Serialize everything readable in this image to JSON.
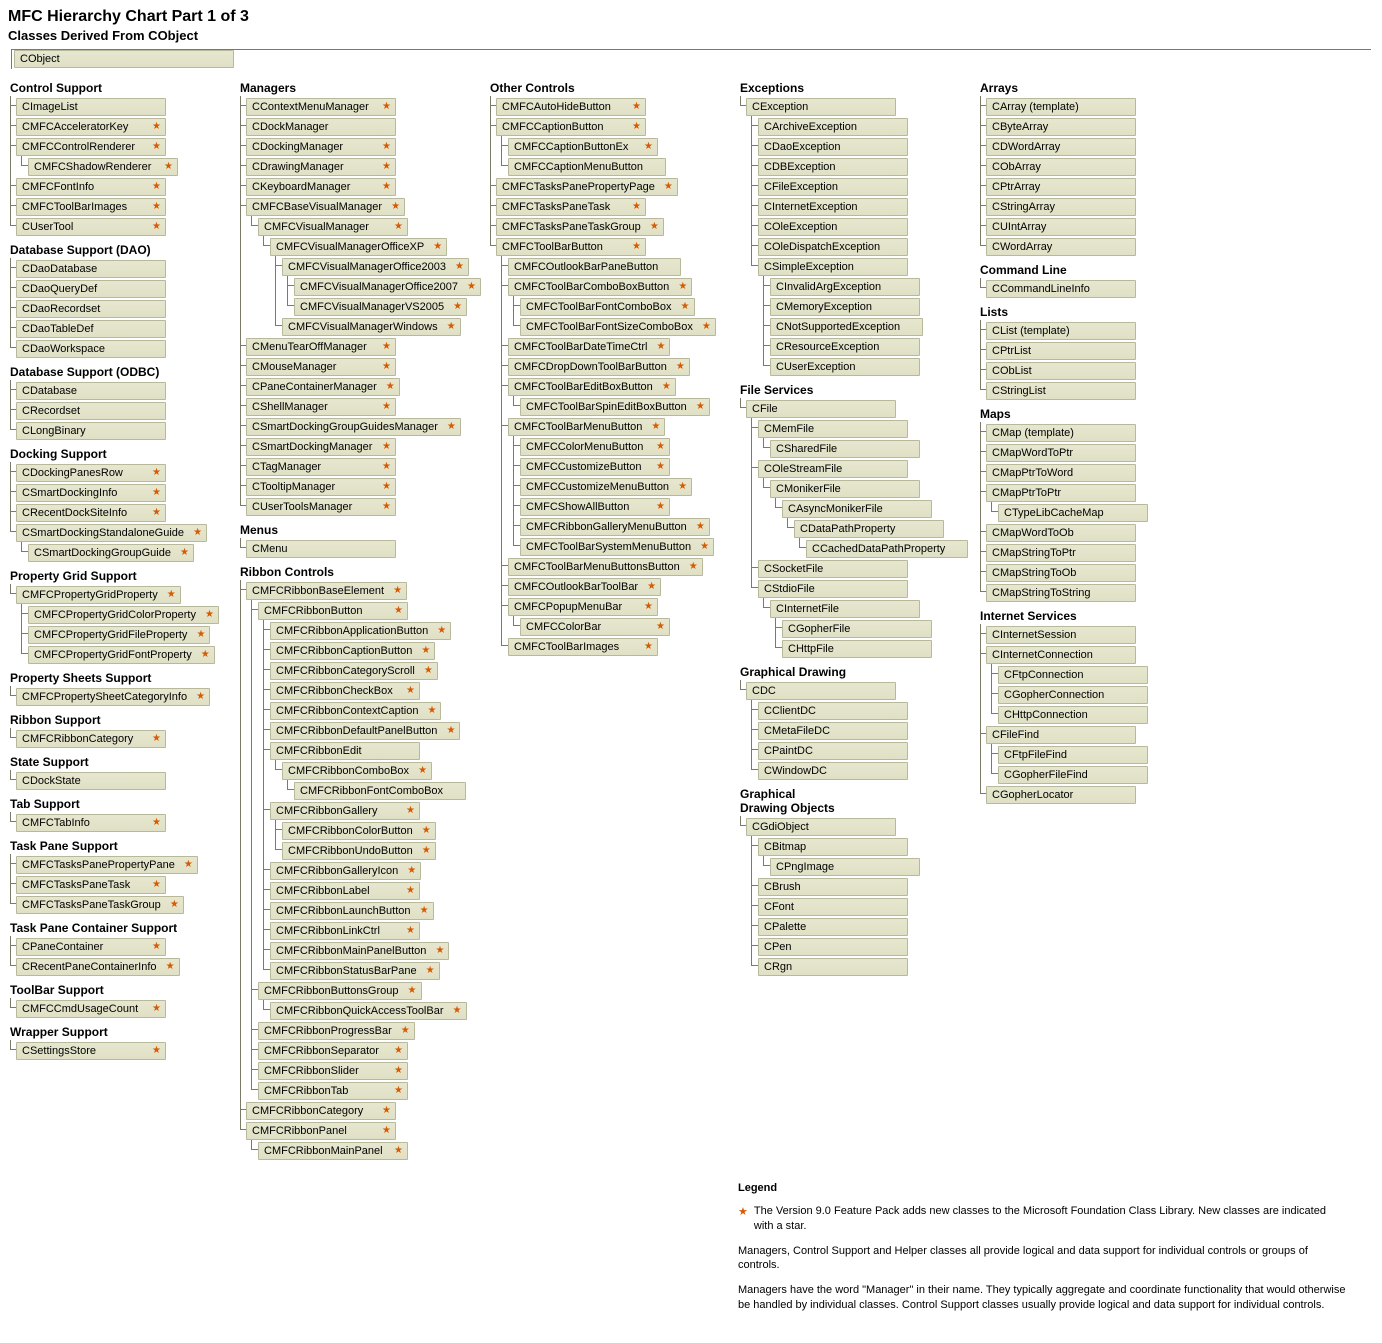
{
  "title": "MFC Hierarchy Chart Part 1 of 3",
  "subtitle": "Classes Derived From CObject",
  "root": "CObject",
  "icons": {
    "star": "star-icon"
  },
  "col1": [
    {
      "heading": "Control Support",
      "items": [
        {
          "n": "CImageList"
        },
        {
          "n": "CMFCAcceleratorKey",
          "s": true
        },
        {
          "n": "CMFCControlRenderer",
          "s": true,
          "c": [
            {
              "n": "CMFCShadowRenderer",
              "s": true
            }
          ]
        },
        {
          "n": "CMFCFontInfo",
          "s": true
        },
        {
          "n": "CMFCToolBarImages",
          "s": true
        },
        {
          "n": "CUserTool",
          "s": true
        }
      ]
    },
    {
      "heading": "Database Support (DAO)",
      "items": [
        {
          "n": "CDaoDatabase"
        },
        {
          "n": "CDaoQueryDef"
        },
        {
          "n": "CDaoRecordset"
        },
        {
          "n": "CDaoTableDef"
        },
        {
          "n": "CDaoWorkspace"
        }
      ]
    },
    {
      "heading": "Database Support (ODBC)",
      "items": [
        {
          "n": "CDatabase"
        },
        {
          "n": "CRecordset"
        },
        {
          "n": "CLongBinary"
        }
      ]
    },
    {
      "heading": "Docking Support",
      "items": [
        {
          "n": "CDockingPanesRow",
          "s": true
        },
        {
          "n": "CSmartDockingInfo",
          "s": true
        },
        {
          "n": "CRecentDockSiteInfo",
          "s": true
        },
        {
          "n": "CSmartDockingStandaloneGuide",
          "s": true,
          "c": [
            {
              "n": "CSmartDockingGroupGuide",
              "s": true
            }
          ]
        }
      ]
    },
    {
      "heading": "Property Grid Support",
      "items": [
        {
          "n": "CMFCPropertyGridProperty",
          "s": true,
          "c": [
            {
              "n": "CMFCPropertyGridColorProperty",
              "s": true
            },
            {
              "n": "CMFCPropertyGridFileProperty",
              "s": true
            },
            {
              "n": "CMFCPropertyGridFontProperty",
              "s": true
            }
          ]
        }
      ]
    },
    {
      "heading": "Property Sheets Support",
      "items": [
        {
          "n": "CMFCPropertySheetCategoryInfo",
          "s": true
        }
      ]
    },
    {
      "heading": "Ribbon Support",
      "items": [
        {
          "n": "CMFCRibbonCategory",
          "s": true
        }
      ]
    },
    {
      "heading": "State Support",
      "items": [
        {
          "n": "CDockState"
        }
      ]
    },
    {
      "heading": "Tab Support",
      "items": [
        {
          "n": "CMFCTabInfo",
          "s": true
        }
      ]
    },
    {
      "heading": "Task Pane Support",
      "items": [
        {
          "n": "CMFCTasksPanePropertyPane",
          "s": true
        },
        {
          "n": "CMFCTasksPaneTask",
          "s": true
        },
        {
          "n": "CMFCTasksPaneTaskGroup",
          "s": true
        }
      ]
    },
    {
      "heading": "Task Pane Container Support",
      "items": [
        {
          "n": "CPaneContainer",
          "s": true
        },
        {
          "n": "CRecentPaneContainerInfo",
          "s": true
        }
      ]
    },
    {
      "heading": "ToolBar Support",
      "items": [
        {
          "n": "CMFCCmdUsageCount",
          "s": true
        }
      ]
    },
    {
      "heading": "Wrapper Support",
      "items": [
        {
          "n": "CSettingsStore",
          "s": true
        }
      ]
    }
  ],
  "col2": [
    {
      "heading": "Managers",
      "items": [
        {
          "n": "CContextMenuManager",
          "s": true
        },
        {
          "n": "CDockManager"
        },
        {
          "n": "CDockingManager",
          "s": true
        },
        {
          "n": "CDrawingManager",
          "s": true
        },
        {
          "n": "CKeyboardManager",
          "s": true
        },
        {
          "n": "CMFCBaseVisualManager",
          "s": true,
          "c": [
            {
              "n": "CMFCVisualManager",
              "s": true,
              "c": [
                {
                  "n": "CMFCVisualManagerOfficeXP",
                  "s": true,
                  "c": [
                    {
                      "n": "CMFCVisualManagerOffice2003",
                      "s": true,
                      "c": [
                        {
                          "n": "CMFCVisualManagerOffice2007",
                          "s": true
                        },
                        {
                          "n": "CMFCVisualManagerVS2005",
                          "s": true
                        }
                      ]
                    },
                    {
                      "n": "CMFCVisualManagerWindows",
                      "s": true
                    }
                  ]
                }
              ]
            }
          ]
        },
        {
          "n": "CMenuTearOffManager",
          "s": true
        },
        {
          "n": "CMouseManager",
          "s": true
        },
        {
          "n": "CPaneContainerManager",
          "s": true
        },
        {
          "n": "CShellManager",
          "s": true
        },
        {
          "n": "CSmartDockingGroupGuidesManager",
          "s": true
        },
        {
          "n": "CSmartDockingManager",
          "s": true
        },
        {
          "n": "CTagManager",
          "s": true
        },
        {
          "n": "CTooltipManager",
          "s": true
        },
        {
          "n": "CUserToolsManager",
          "s": true
        }
      ]
    },
    {
      "heading": "Menus",
      "items": [
        {
          "n": "CMenu"
        }
      ]
    },
    {
      "heading": "Ribbon Controls",
      "items": [
        {
          "n": "CMFCRibbonBaseElement",
          "s": true,
          "c": [
            {
              "n": "CMFCRibbonButton",
              "s": true,
              "c": [
                {
                  "n": "CMFCRibbonApplicationButton",
                  "s": true
                },
                {
                  "n": "CMFCRibbonCaptionButton",
                  "s": true
                },
                {
                  "n": "CMFCRibbonCategoryScroll",
                  "s": true
                },
                {
                  "n": "CMFCRibbonCheckBox",
                  "s": true
                },
                {
                  "n": "CMFCRibbonContextCaption",
                  "s": true
                },
                {
                  "n": "CMFCRibbonDefaultPanelButton",
                  "s": true
                },
                {
                  "n": "CMFCRibbonEdit",
                  "c": [
                    {
                      "n": "CMFCRibbonComboBox",
                      "s": true,
                      "c": [
                        {
                          "n": "CMFCRibbonFontComboBox"
                        }
                      ]
                    }
                  ]
                },
                {
                  "n": "CMFCRibbonGallery",
                  "s": true,
                  "c": [
                    {
                      "n": "CMFCRibbonColorButton",
                      "s": true
                    },
                    {
                      "n": "CMFCRibbonUndoButton",
                      "s": true
                    }
                  ]
                },
                {
                  "n": "CMFCRibbonGalleryIcon",
                  "s": true
                },
                {
                  "n": "CMFCRibbonLabel",
                  "s": true
                },
                {
                  "n": "CMFCRibbonLaunchButton",
                  "s": true
                },
                {
                  "n": "CMFCRibbonLinkCtrl",
                  "s": true
                },
                {
                  "n": "CMFCRibbonMainPanelButton",
                  "s": true
                },
                {
                  "n": "CMFCRibbonStatusBarPane",
                  "s": true
                }
              ]
            },
            {
              "n": "CMFCRibbonButtonsGroup",
              "s": true,
              "c": [
                {
                  "n": "CMFCRibbonQuickAccessToolBar",
                  "s": true
                }
              ]
            },
            {
              "n": "CMFCRibbonProgressBar",
              "s": true
            },
            {
              "n": "CMFCRibbonSeparator",
              "s": true
            },
            {
              "n": "CMFCRibbonSlider",
              "s": true
            },
            {
              "n": "CMFCRibbonTab",
              "s": true
            }
          ]
        },
        {
          "n": "CMFCRibbonCategory",
          "s": true
        },
        {
          "n": "CMFCRibbonPanel",
          "s": true,
          "c": [
            {
              "n": "CMFCRibbonMainPanel",
              "s": true
            }
          ]
        }
      ]
    }
  ],
  "col3": [
    {
      "heading": "Other Controls",
      "items": [
        {
          "n": "CMFCAutoHideButton",
          "s": true
        },
        {
          "n": "CMFCCaptionButton",
          "s": true,
          "c": [
            {
              "n": "CMFCCaptionButtonEx",
              "s": true
            },
            {
              "n": "CMFCCaptionMenuButton"
            }
          ]
        },
        {
          "n": "CMFCTasksPanePropertyPage",
          "s": true
        },
        {
          "n": "CMFCTasksPaneTask",
          "s": true
        },
        {
          "n": "CMFCTasksPaneTaskGroup",
          "s": true
        },
        {
          "n": "CMFCToolBarButton",
          "s": true,
          "c": [
            {
              "n": "CMFCOutlookBarPaneButton"
            },
            {
              "n": "CMFCToolBarComboBoxButton",
              "s": true,
              "c": [
                {
                  "n": "CMFCToolBarFontComboBox",
                  "s": true
                },
                {
                  "n": "CMFCToolBarFontSizeComboBox",
                  "s": true
                }
              ]
            },
            {
              "n": "CMFCToolBarDateTimeCtrl",
              "s": true
            },
            {
              "n": "CMFCDropDownToolBarButton",
              "s": true
            },
            {
              "n": "CMFCToolBarEditBoxButton",
              "s": true,
              "c": [
                {
                  "n": "CMFCToolBarSpinEditBoxButton",
                  "s": true
                }
              ]
            },
            {
              "n": "CMFCToolBarMenuButton",
              "s": true,
              "c": [
                {
                  "n": "CMFCColorMenuButton",
                  "s": true
                },
                {
                  "n": "CMFCCustomizeButton",
                  "s": true
                },
                {
                  "n": "CMFCCustomizeMenuButton",
                  "s": true
                },
                {
                  "n": "CMFCShowAllButton",
                  "s": true
                },
                {
                  "n": "CMFCRibbonGalleryMenuButton",
                  "s": true
                },
                {
                  "n": "CMFCToolBarSystemMenuButton",
                  "s": true
                }
              ]
            },
            {
              "n": "CMFCToolBarMenuButtonsButton",
              "s": true
            },
            {
              "n": "CMFCOutlookBarToolBar",
              "s": true
            },
            {
              "n": "CMFCPopupMenuBar",
              "s": true,
              "c": [
                {
                  "n": "CMFCColorBar",
                  "s": true
                }
              ]
            },
            {
              "n": "CMFCToolBarImages",
              "s": true
            }
          ]
        }
      ]
    }
  ],
  "col4": [
    {
      "heading": "Exceptions",
      "items": [
        {
          "n": "CException",
          "c": [
            {
              "n": "CArchiveException"
            },
            {
              "n": "CDaoException"
            },
            {
              "n": "CDBException"
            },
            {
              "n": "CFileException"
            },
            {
              "n": "CInternetException"
            },
            {
              "n": "COleException"
            },
            {
              "n": "COleDispatchException"
            },
            {
              "n": "CSimpleException",
              "c": [
                {
                  "n": "CInvalidArgException"
                },
                {
                  "n": "CMemoryException"
                },
                {
                  "n": "CNotSupportedException"
                },
                {
                  "n": "CResourceException"
                },
                {
                  "n": "CUserException"
                }
              ]
            }
          ]
        }
      ]
    },
    {
      "heading": "File Services",
      "items": [
        {
          "n": "CFile",
          "c": [
            {
              "n": "CMemFile",
              "c": [
                {
                  "n": "CSharedFile"
                }
              ]
            },
            {
              "n": "COleStreamFile",
              "c": [
                {
                  "n": "CMonikerFile",
                  "c": [
                    {
                      "n": "CAsyncMonikerFile",
                      "c": [
                        {
                          "n": "CDataPathProperty",
                          "c": [
                            {
                              "n": "CCachedDataPathProperty"
                            }
                          ]
                        }
                      ]
                    }
                  ]
                }
              ]
            },
            {
              "n": "CSocketFile"
            },
            {
              "n": "CStdioFile",
              "c": [
                {
                  "n": "CInternetFile",
                  "c": [
                    {
                      "n": "CGopherFile"
                    },
                    {
                      "n": "CHttpFile"
                    }
                  ]
                }
              ]
            }
          ]
        }
      ]
    },
    {
      "heading": "Graphical Drawing",
      "items": [
        {
          "n": "CDC",
          "c": [
            {
              "n": "CClientDC"
            },
            {
              "n": "CMetaFileDC"
            },
            {
              "n": "CPaintDC"
            },
            {
              "n": "CWindowDC"
            }
          ]
        }
      ]
    },
    {
      "heading": "Graphical\nDrawing Objects",
      "items": [
        {
          "n": "CGdiObject",
          "c": [
            {
              "n": "CBitmap",
              "c": [
                {
                  "n": "CPngImage"
                }
              ]
            },
            {
              "n": "CBrush"
            },
            {
              "n": "CFont"
            },
            {
              "n": "CPalette"
            },
            {
              "n": "CPen"
            },
            {
              "n": "CRgn"
            }
          ]
        }
      ]
    }
  ],
  "col5": [
    {
      "heading": "Arrays",
      "items": [
        {
          "n": "CArray (template)"
        },
        {
          "n": "CByteArray"
        },
        {
          "n": "CDWordArray"
        },
        {
          "n": "CObArray"
        },
        {
          "n": "CPtrArray"
        },
        {
          "n": "CStringArray"
        },
        {
          "n": "CUIntArray"
        },
        {
          "n": "CWordArray"
        }
      ]
    },
    {
      "heading": "Command Line",
      "items": [
        {
          "n": "CCommandLineInfo"
        }
      ]
    },
    {
      "heading": "Lists",
      "items": [
        {
          "n": "CList (template)"
        },
        {
          "n": "CPtrList"
        },
        {
          "n": "CObList"
        },
        {
          "n": "CStringList"
        }
      ]
    },
    {
      "heading": "Maps",
      "items": [
        {
          "n": "CMap (template)"
        },
        {
          "n": "CMapWordToPtr"
        },
        {
          "n": "CMapPtrToWord"
        },
        {
          "n": "CMapPtrToPtr",
          "c": [
            {
              "n": "CTypeLibCacheMap"
            }
          ]
        },
        {
          "n": "CMapWordToOb"
        },
        {
          "n": "CMapStringToPtr"
        },
        {
          "n": "CMapStringToOb"
        },
        {
          "n": "CMapStringToString"
        }
      ]
    },
    {
      "heading": "Internet Services",
      "items": [
        {
          "n": "CInternetSession"
        },
        {
          "n": "CInternetConnection",
          "c": [
            {
              "n": "CFtpConnection"
            },
            {
              "n": "CGopherConnection"
            },
            {
              "n": "CHttpConnection"
            }
          ]
        },
        {
          "n": "CFileFind",
          "c": [
            {
              "n": "CFtpFileFind"
            },
            {
              "n": "CGopherFileFind"
            }
          ]
        },
        {
          "n": "CGopherLocator"
        }
      ]
    }
  ],
  "legend": {
    "heading": "Legend",
    "p1": "The Version 9.0 Feature Pack adds new classes to the Microsoft Foundation Class Library. New classes are indicated with a star.",
    "p2": "Managers, Control Support and Helper classes all provide logical and data support for individual controls or groups of controls.",
    "p3": "Managers have the word \"Manager\" in their name. They typically aggregate and coordinate functionality that would otherwise be handled by individual classes. Control Support classes usually provide logical and data support for individual controls."
  }
}
